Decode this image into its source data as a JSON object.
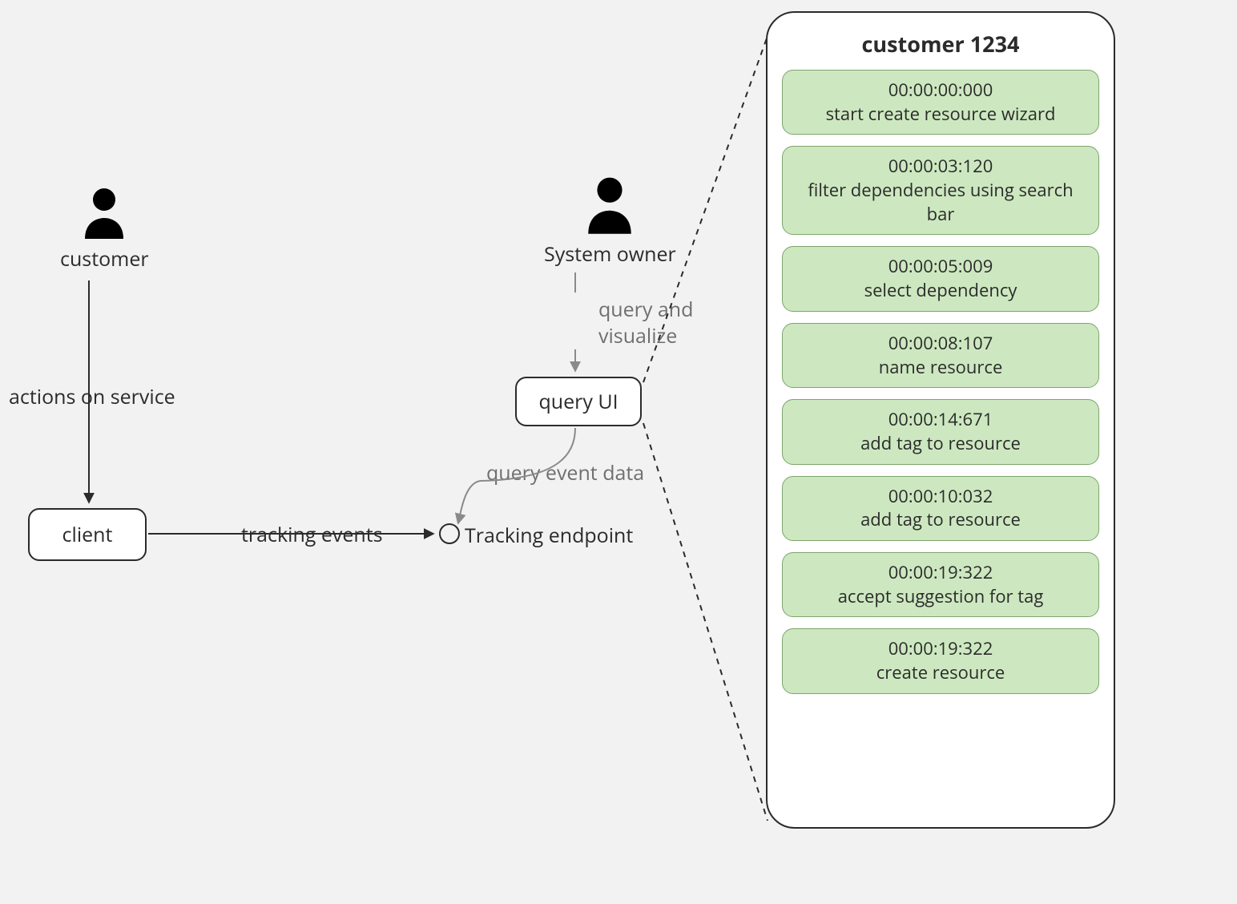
{
  "actors": {
    "customer": {
      "label": "customer"
    },
    "system_owner": {
      "label": "System owner"
    }
  },
  "nodes": {
    "client": {
      "label": "client"
    },
    "query_ui": {
      "label": "query UI"
    },
    "tracking_endpoint": {
      "label": "Tracking endpoint"
    }
  },
  "edges": {
    "actions_on_service": {
      "label": "actions on service"
    },
    "tracking_events": {
      "label": "tracking events"
    },
    "query_and_visualize_line1": "query and",
    "query_and_visualize_line2": "visualize",
    "query_event_data": {
      "label": "query event data"
    }
  },
  "timeline": {
    "title": "customer 1234",
    "events": [
      {
        "ts": "00:00:00:000",
        "label": "start create resource wizard"
      },
      {
        "ts": "00:00:03:120",
        "label": "filter dependencies using search bar"
      },
      {
        "ts": "00:00:05:009",
        "label": "select dependency"
      },
      {
        "ts": "00:00:08:107",
        "label": "name resource"
      },
      {
        "ts": "00:00:14:671",
        "label": "add tag to resource"
      },
      {
        "ts": "00:00:10:032",
        "label": "add tag to resource"
      },
      {
        "ts": "00:00:19:322",
        "label": "accept suggestion for tag"
      },
      {
        "ts": "00:00:19:322",
        "label": "create resource"
      }
    ]
  }
}
